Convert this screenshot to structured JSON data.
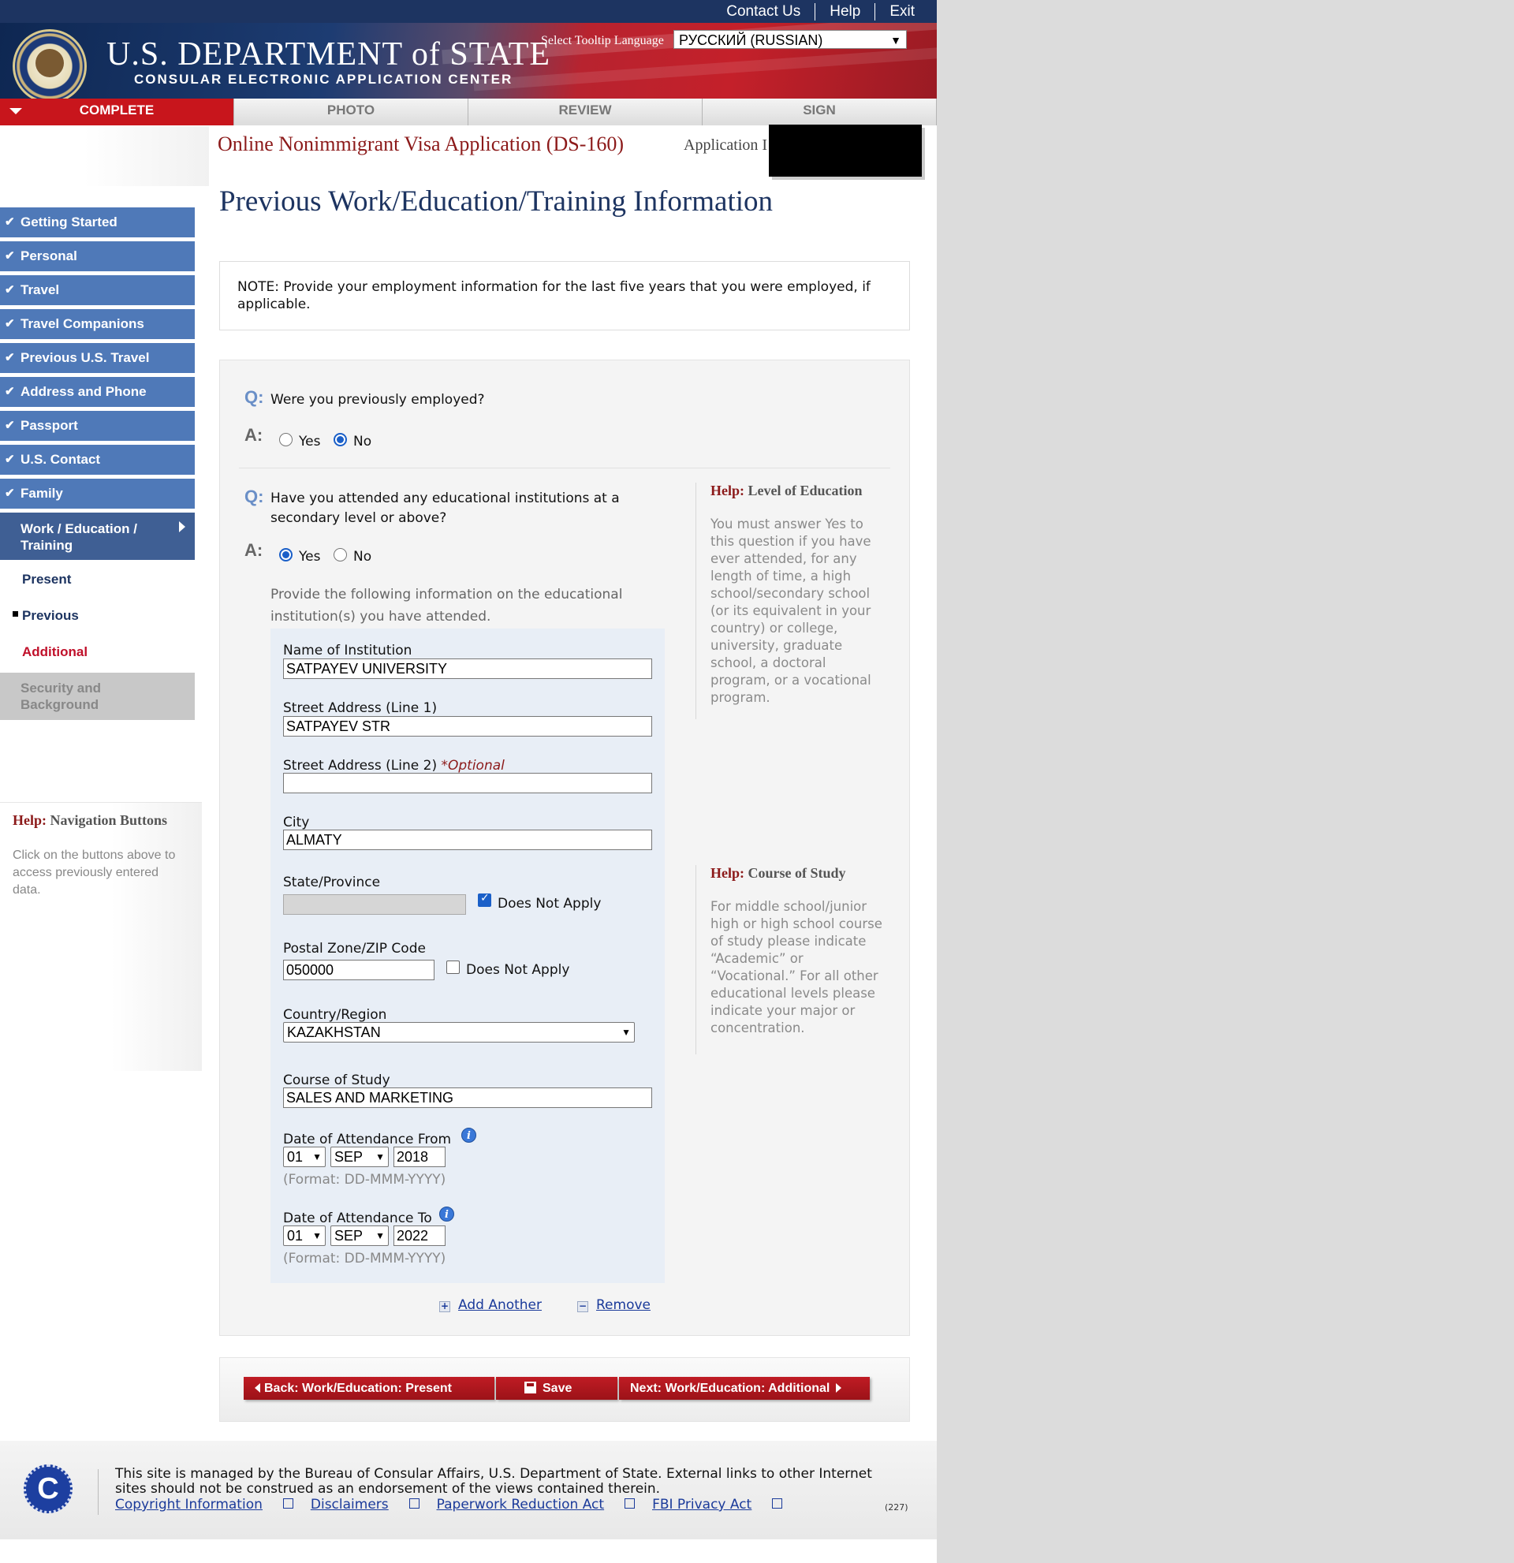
{
  "header": {
    "links": [
      "Contact Us",
      "Help",
      "Exit"
    ],
    "dept_title": "U.S. DEPARTMENT of STATE",
    "dept_subtitle": "CONSULAR ELECTRONIC APPLICATION CENTER",
    "tooltip_label": "Select Tooltip Language",
    "tooltip_language": "РУССКИЙ (RUSSIAN)"
  },
  "tabs": [
    "COMPLETE",
    "PHOTO",
    "REVIEW",
    "SIGN"
  ],
  "form_title": "Online Nonimmigrant Visa Application (DS-160)",
  "application_label": "Application I",
  "page_title": "Previous Work/Education/Training Information",
  "sidebar": {
    "items": [
      "Getting Started",
      "Personal",
      "Travel",
      "Travel Companions",
      "Previous U.S. Travel",
      "Address and Phone",
      "Passport",
      "U.S. Contact",
      "Family"
    ],
    "current": "Work / Education / Training",
    "subitems": [
      "Present",
      "Previous",
      "Additional"
    ],
    "disabled": "Security and Background"
  },
  "nav_help": {
    "prefix": "Help:",
    "title": "Navigation Buttons",
    "text": "Click on the buttons above to access previously entered data."
  },
  "note": "NOTE: Provide your employment information for the last five years that you were employed, if applicable.",
  "questions": {
    "q_marker": "Q:",
    "a_marker": "A:",
    "employed_q": "Were you previously employed?",
    "employed_answer": "No",
    "education_q": "Have you attended any educational institutions at a secondary level or above?",
    "education_answer": "Yes",
    "yes_label": "Yes",
    "no_label": "No",
    "instructions": "Provide the following information on the educational institution(s) you have attended."
  },
  "help_level": {
    "prefix": "Help:",
    "title": "Level of Education",
    "text": "You must answer Yes to this question if you have ever attended, for any length of time, a high school/secondary school (or its equivalent in your country) or college, university, graduate school, a doctoral program, or a vocational program."
  },
  "help_course": {
    "prefix": "Help:",
    "title": "Course of Study",
    "text": "For middle school/junior high or high school course of study please indicate “Academic” or “Vocational.” For all other educational levels please indicate your major or concentration."
  },
  "fields": {
    "institution_label": "Name of Institution",
    "institution_value": "SATPAYEV UNIVERSITY",
    "street1_label": "Street Address (Line 1)",
    "street1_value": "SATPAYEV STR",
    "street2_label": "Street Address (Line 2)",
    "optional": "*Optional",
    "street2_value": "",
    "city_label": "City",
    "city_value": "ALMATY",
    "state_label": "State/Province",
    "state_value": "",
    "does_not_apply": "Does Not Apply",
    "state_dna_checked": true,
    "zip_label": "Postal Zone/ZIP Code",
    "zip_value": "050000",
    "zip_dna_checked": false,
    "country_label": "Country/Region",
    "country_value": "KAZAKHSTAN",
    "course_label": "Course of Study",
    "course_value": "SALES AND MARKETING",
    "from_label": "Date of Attendance From",
    "from_day": "01",
    "from_month": "SEP",
    "from_year": "2018",
    "to_label": "Date of Attendance To",
    "to_day": "01",
    "to_month": "SEP",
    "to_year": "2022",
    "format_hint": "(Format: DD-MMM-YYYY)"
  },
  "actions": {
    "add_another": "Add Another",
    "remove": "Remove"
  },
  "buttons": {
    "back": "Back: Work/Education: Present",
    "save": "Save",
    "next": "Next: Work/Education: Additional"
  },
  "footer": {
    "logo_letter": "C",
    "text": "This site is managed by the Bureau of Consular Affairs, U.S. Department of State. External links to other Internet sites should not be construed as an endorsement of the views contained therein.",
    "links": [
      "Copyright Information",
      "Disclaimers",
      "Paperwork Reduction Act",
      "FBI Privacy Act"
    ],
    "version": "(227)"
  },
  "colors": {
    "nav_blue": "#4f79b8",
    "accent_red": "#c8151c",
    "header_navy": "#1d3461"
  }
}
